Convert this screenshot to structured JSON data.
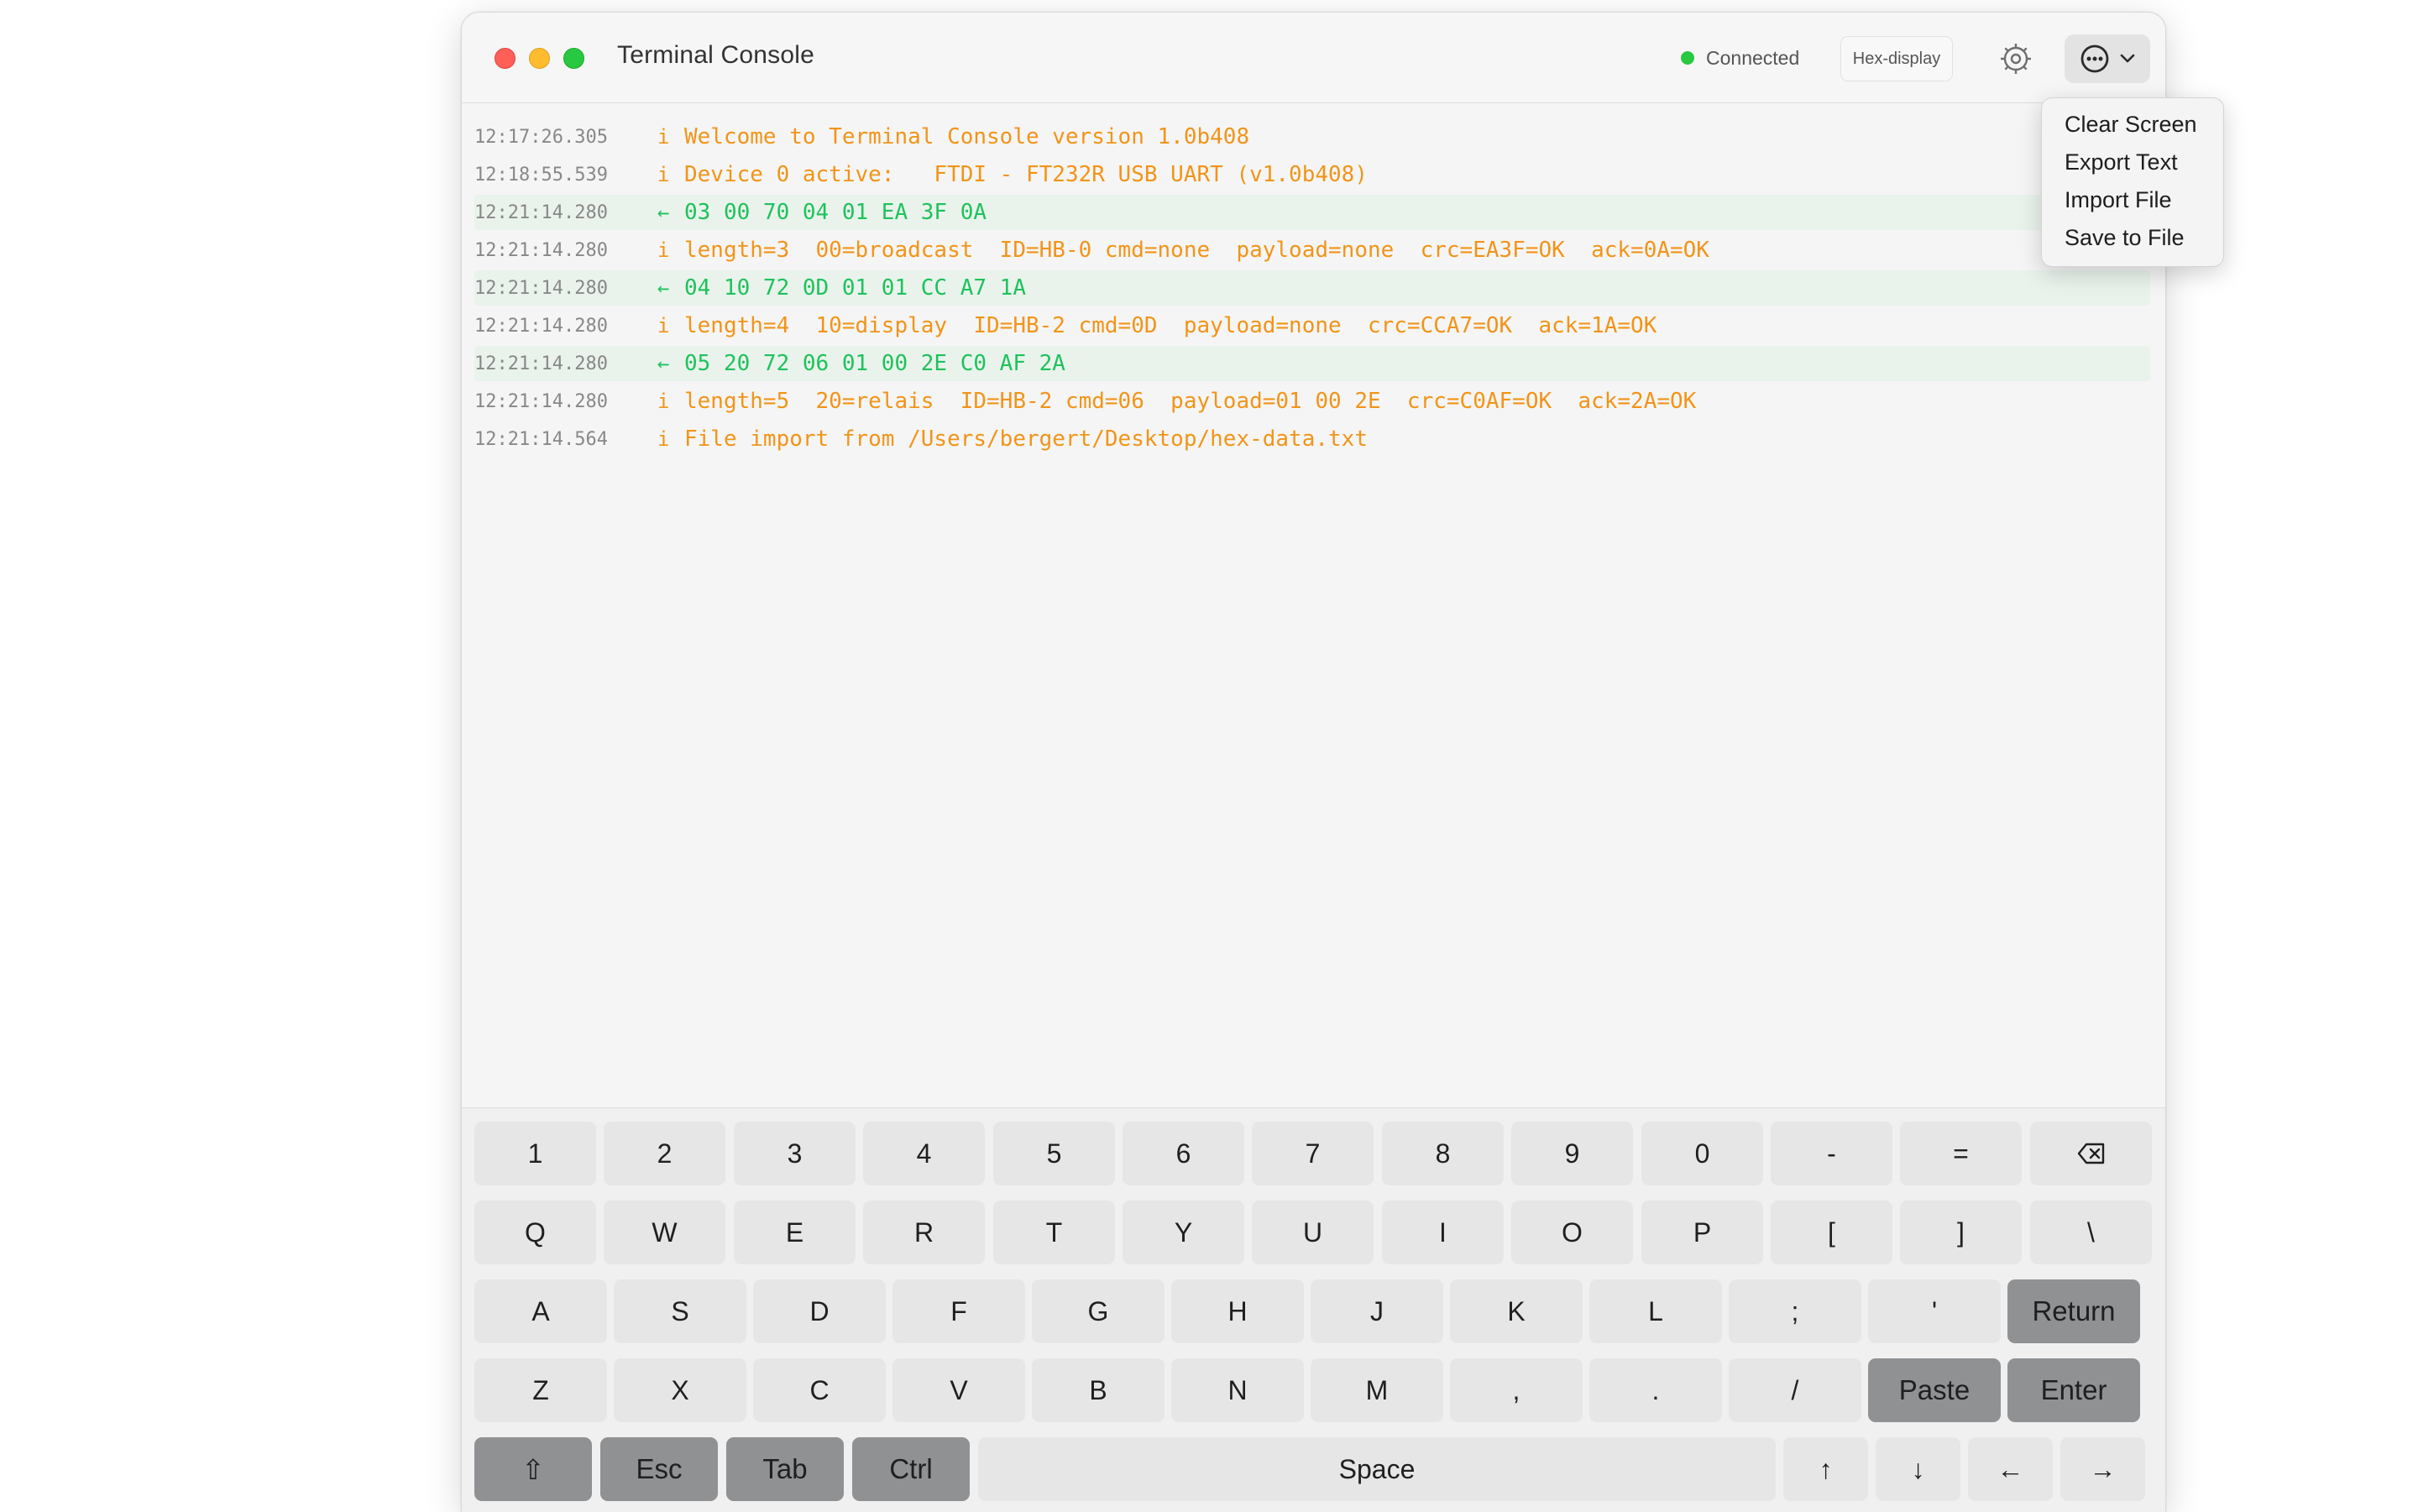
{
  "window": {
    "title": "Terminal Console",
    "status": "Connected",
    "hex_display": "Hex-display"
  },
  "console": {
    "lines": [
      {
        "time": "12:17:26.305",
        "marker": "i",
        "kind": "info",
        "text": "Welcome to Terminal Console version 1.0b408"
      },
      {
        "time": "12:18:55.539",
        "marker": "i",
        "kind": "info",
        "text": "Device 0 active:   FTDI - FT232R USB UART (v1.0b408)"
      },
      {
        "time": "12:21:14.280",
        "marker": "←",
        "kind": "recv",
        "text": "03 00 70 04 01 EA 3F 0A"
      },
      {
        "time": "12:21:14.280",
        "marker": "i",
        "kind": "info",
        "text": "length=3  00=broadcast  ID=HB-0 cmd=none  payload=none  crc=EA3F=OK  ack=0A=OK"
      },
      {
        "time": "12:21:14.280",
        "marker": "←",
        "kind": "recv",
        "text": "04 10 72 0D 01 01 CC A7 1A"
      },
      {
        "time": "12:21:14.280",
        "marker": "i",
        "kind": "info",
        "text": "length=4  10=display  ID=HB-2 cmd=0D  payload=none  crc=CCA7=OK  ack=1A=OK"
      },
      {
        "time": "12:21:14.280",
        "marker": "←",
        "kind": "recv",
        "text": "05 20 72 06 01 00 2E C0 AF 2A"
      },
      {
        "time": "12:21:14.280",
        "marker": "i",
        "kind": "info",
        "text": "length=5  20=relais  ID=HB-2 cmd=06  payload=01 00 2E  crc=C0AF=OK  ack=2A=OK"
      },
      {
        "time": "12:21:14.564",
        "marker": "i",
        "kind": "info",
        "text": "File import from /Users/bergert/Desktop/hex-data.txt"
      }
    ]
  },
  "menu": {
    "items": [
      "Clear Screen",
      "Export Text",
      "Import File",
      "Save to File"
    ]
  },
  "keyboard": {
    "rows": [
      [
        "1",
        "2",
        "3",
        "4",
        "5",
        "6",
        "7",
        "8",
        "9",
        "0",
        "-",
        "=",
        "⌫"
      ],
      [
        "Q",
        "W",
        "E",
        "R",
        "T",
        "Y",
        "U",
        "I",
        "O",
        "P",
        "[",
        "]",
        "\\"
      ],
      [
        "A",
        "S",
        "D",
        "F",
        "G",
        "H",
        "J",
        "K",
        "L",
        ";",
        "'",
        "Return"
      ],
      [
        "Z",
        "X",
        "C",
        "V",
        "B",
        "N",
        "M",
        ",",
        ".",
        "/",
        "Paste",
        "Enter"
      ],
      [
        "⇧",
        "Esc",
        "Tab",
        "Ctrl",
        "Space",
        "↑",
        "↓",
        "←",
        "→"
      ]
    ]
  },
  "colors": {
    "info_text": "#f29418",
    "recv_text": "#1ec25b",
    "status_dot": "#28c840",
    "dark_key": "#8f9193"
  },
  "icons": {
    "settings": "gear-icon",
    "more": "ellipsis-circle-icon",
    "dropdown": "chevron-down-icon",
    "backspace": "backspace-icon"
  }
}
